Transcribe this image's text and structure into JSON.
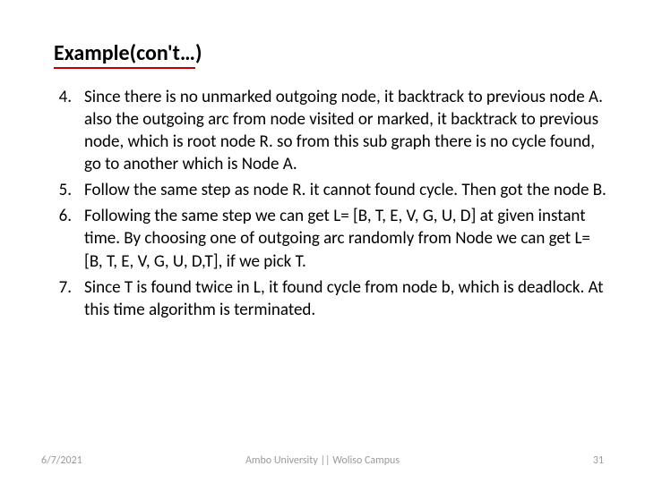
{
  "title_prefix": "Example(con't…",
  "title_suffix": ")",
  "items": [
    {
      "num": "4.",
      "text": "Since there is no unmarked outgoing node, it backtrack to previous node A. also the outgoing arc from node visited or marked, it backtrack to previous node, which is root node R. so from this sub graph there is no cycle found, go to another which is Node A."
    },
    {
      "num": "5.",
      "text": "Follow the same step as node R. it cannot found cycle. Then got the node B."
    },
    {
      "num": "6.",
      "text": "Following the same step we can get L= [B, T, E, V, G, U, D] at given instant time.  By choosing one of outgoing arc randomly from Node we can get L= [B, T, E, V, G, U, D,T], if we pick T."
    },
    {
      "num": "7.",
      "text": "Since T is found twice in L, it found cycle from node b, which is deadlock. At this time algorithm is terminated."
    }
  ],
  "footer": {
    "date": "6/7/2021",
    "center": "Ambo University || Woliso Campus",
    "page": "31"
  }
}
